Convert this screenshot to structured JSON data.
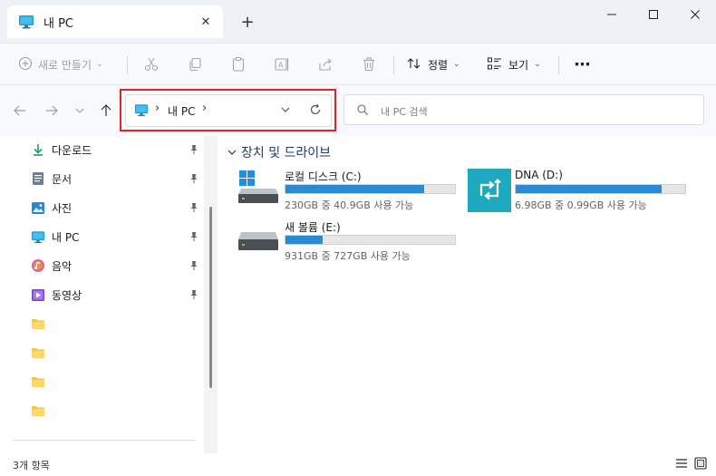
{
  "window": {
    "tab_title": "내 PC",
    "new_tab_label": "+",
    "close_tab_label": "✕"
  },
  "commandbar": {
    "new_label": "새로 만들기",
    "sort_label": "정렬",
    "view_label": "보기",
    "more_label": "⋯"
  },
  "address": {
    "location": "내 PC",
    "separator": "›"
  },
  "search": {
    "placeholder": "내 PC 검색"
  },
  "sidebar": {
    "items": [
      {
        "label": "다운로드",
        "icon": "download-icon",
        "pinned": true
      },
      {
        "label": "문서",
        "icon": "document-icon",
        "pinned": true
      },
      {
        "label": "사진",
        "icon": "pictures-icon",
        "pinned": true
      },
      {
        "label": "내 PC",
        "icon": "pc-icon",
        "pinned": true
      },
      {
        "label": "음악",
        "icon": "music-icon",
        "pinned": true
      },
      {
        "label": "동영상",
        "icon": "video-icon",
        "pinned": true
      },
      {
        "label": "",
        "icon": "folder-icon",
        "pinned": false
      },
      {
        "label": "",
        "icon": "folder-icon",
        "pinned": false
      },
      {
        "label": "",
        "icon": "folder-icon",
        "pinned": false
      },
      {
        "label": "",
        "icon": "folder-icon",
        "pinned": false
      }
    ]
  },
  "content": {
    "group_title": "장치 및 드라이브",
    "drives": [
      {
        "name": "로컬 디스크 (C:)",
        "free_text": "230GB 중 40.9GB 사용 가능",
        "used_fraction": 0.82,
        "icon": "windows-drive-icon"
      },
      {
        "name": "DNA (D:)",
        "free_text": "6.98GB 중 0.99GB 사용 가능",
        "used_fraction": 0.86,
        "icon": "sync-drive-icon"
      },
      {
        "name": "새 볼륨 (E:)",
        "free_text": "931GB 중 727GB 사용 가능",
        "used_fraction": 0.22,
        "icon": "hard-drive-icon"
      }
    ]
  },
  "statusbar": {
    "item_count": "3개 항목"
  },
  "colors": {
    "accent": "#2a8ad4",
    "highlight_border": "#d9262b",
    "tile_teal": "#1fa9c0"
  }
}
